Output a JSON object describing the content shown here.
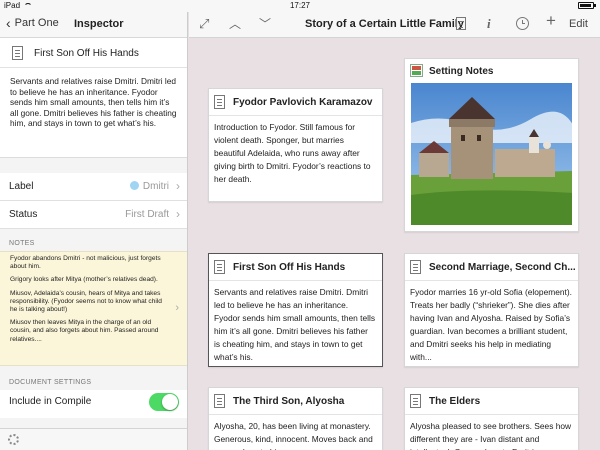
{
  "status_bar": {
    "device": "iPad",
    "time": "17:27"
  },
  "sidebar": {
    "back_label": "Part One",
    "title": "Inspector",
    "doc_title": "First Son Off His Hands",
    "synopsis": "Servants and relatives raise Dmitri. Dmitri led to believe he has an inheritance. Fyodor sends him small amounts, then tells him it’s all gone. Dmitri believes his father is cheating him, and stays in town to get what’s his.",
    "label": {
      "key": "Label",
      "value": "Dmitri",
      "color": "#9fd4f3"
    },
    "status": {
      "key": "Status",
      "value": "First Draft"
    },
    "notes_header": "NOTES",
    "notes": [
      "Fyodor abandons Dmitri - not malicious, just forgets about him.",
      "Grigory looks after Mitya (mother’s relatives dead).",
      "Miusov, Adelaida’s cousin, hears of Mitya and takes responsibility. (Fyodor seems not to know what child he is talking about!)",
      "Miusov then leaves Mitya in the charge of an old cousin, and also forgets about him. Passed around relatives...."
    ],
    "doc_settings_header": "DOCUMENT SETTINGS",
    "include_in_compile": "Include in Compile"
  },
  "toolbar": {
    "title": "Story of a Certain Little Family",
    "edit_label": "Edit",
    "plus_label": "+",
    "info_label": "i"
  },
  "cards": [
    {
      "title": "Fyodor Pavlovich  Karamazov",
      "body": "Introduction to Fyodor. Still famous for violent death. Sponger, but marries beautiful Adelaida, who runs away after giving birth to Dmitri. Fyodor’s reactions to her death."
    },
    {
      "title": "Setting Notes"
    },
    {
      "title": "First Son Off His Hands",
      "body": "Servants and relatives raise Dmitri. Dmitri led to believe he has an inheritance. Fyodor sends him small amounts, then tells him it’s all gone. Dmitri believes his father is cheating him, and stays in town to get what’s his."
    },
    {
      "title": "Second Marriage, Second Ch...",
      "body": "Fyodor marries 16 yr-old Sofia (elopement). Treats her badly (“shrieker”). She dies after having Ivan and Alyosha. Raised by Sofia’s guardian. Ivan becomes a brilliant student, and Dmitri seeks his help in mediating with..."
    },
    {
      "title": "The Third Son, Alyosha",
      "body": "Alyosha, 20, has been living at monastery. Generous, kind, innocent. Moves back and grows close to his"
    },
    {
      "title": "The Elders",
      "body": "Alyosha pleased to see brothers. Sees how different they are - Ivan distant and intellectual. Grows close to Dmitri"
    }
  ]
}
